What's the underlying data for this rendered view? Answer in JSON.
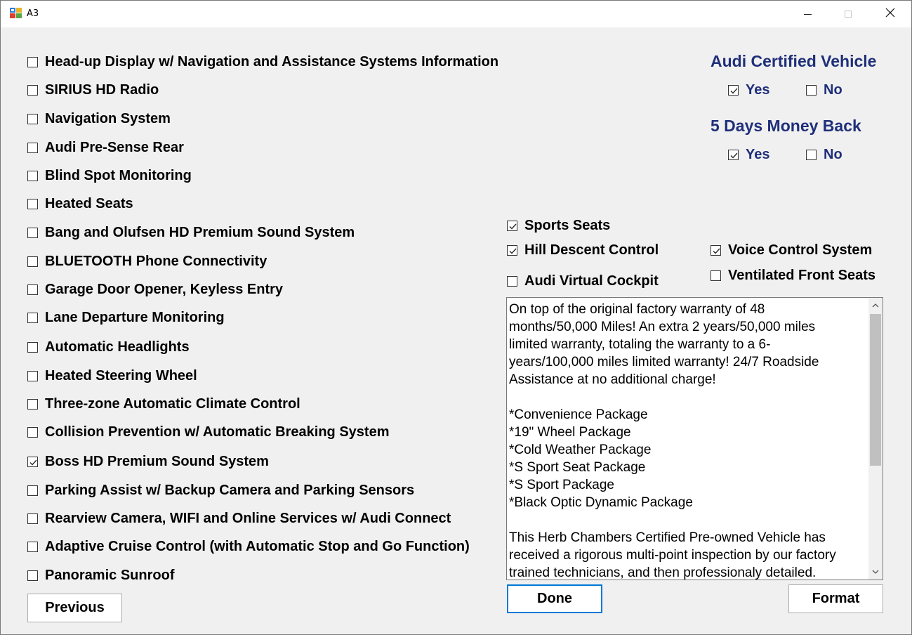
{
  "window": {
    "title": "A3",
    "icons": {
      "app": "app-icon",
      "minimize": "minimize-icon",
      "maximize": "maximize-icon",
      "close": "close-icon"
    }
  },
  "features": [
    {
      "label": "Head-up Display w/ Navigation and Assistance Systems Information",
      "checked": false
    },
    {
      "label": "SIRIUS HD Radio",
      "checked": false
    },
    {
      "label": "Navigation System",
      "checked": false
    },
    {
      "label": "Audi Pre-Sense Rear",
      "checked": false
    },
    {
      "label": "Blind Spot Monitoring",
      "checked": false
    },
    {
      "label": "Heated Seats",
      "checked": false
    },
    {
      "label": "Bang and Olufsen HD Premium Sound System",
      "checked": false
    },
    {
      "label": "BLUETOOTH Phone Connectivity",
      "checked": false
    },
    {
      "label": "Garage Door Opener, Keyless Entry",
      "checked": false
    },
    {
      "label": "Lane Departure Monitoring",
      "checked": false
    },
    {
      "label": "Automatic Headlights",
      "checked": false
    },
    {
      "label": "Heated Steering Wheel",
      "checked": false
    },
    {
      "label": "Three-zone Automatic Climate Control",
      "checked": false
    },
    {
      "label": "Collision Prevention w/ Automatic Breaking System",
      "checked": false
    },
    {
      "label": "Boss HD Premium Sound System",
      "checked": true
    },
    {
      "label": "Parking Assist w/ Backup Camera and Parking Sensors",
      "checked": false
    },
    {
      "label": "Rearview Camera, WIFI and Online Services w/ Audi Connect",
      "checked": false
    },
    {
      "label": "Adaptive Cruise Control (with Automatic Stop and Go Function)",
      "checked": false
    },
    {
      "label": "Panoramic Sunroof",
      "checked": false
    }
  ],
  "extras": {
    "sports_seats": {
      "label": "Sports Seats",
      "checked": true
    },
    "hill_descent": {
      "label": "Hill Descent Control",
      "checked": true
    },
    "virtual_cockpit": {
      "label": "Audi Virtual Cockpit",
      "checked": false
    },
    "voice_control": {
      "label": "Voice Control System",
      "checked": true
    },
    "ventilated_seats": {
      "label": "Ventilated Front Seats",
      "checked": false
    }
  },
  "certified": {
    "heading": "Audi Certified Vehicle",
    "yes": {
      "label": "Yes",
      "checked": true
    },
    "no": {
      "label": "No",
      "checked": false
    }
  },
  "money_back": {
    "heading": "5 Days Money Back",
    "yes": {
      "label": "Yes",
      "checked": true
    },
    "no": {
      "label": "No",
      "checked": false
    }
  },
  "description": "On top of the original factory warranty of 48\nmonths/50,000 Miles! An extra 2 years/50,000 miles\nlimited warranty, totaling the warranty to a 6-\nyears/100,000 miles limited warranty! 24/7 Roadside\nAssistance at no additional charge!\n\n*Convenience Package\n*19\" Wheel Package\n*Cold Weather Package\n*S Sport Seat Package\n*S Sport Package\n*Black Optic Dynamic Package\n\nThis Herb Chambers Certified Pre-owned Vehicle has\nreceived a rigorous multi-point inspection by our factory\ntrained technicians, and then professionaly detailed.",
  "buttons": {
    "previous": "Previous",
    "done": "Done",
    "format": "Format"
  },
  "colors": {
    "accent_blue": "#1f2f7a",
    "focus_border": "#0078d7",
    "background": "#f0f0f0"
  }
}
